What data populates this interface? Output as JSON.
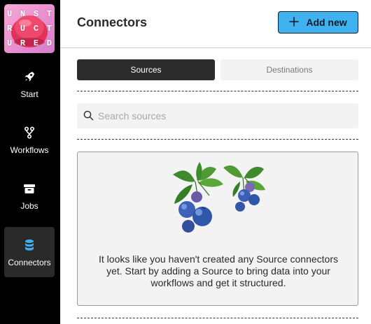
{
  "logo": {
    "rows": [
      [
        "U",
        "N",
        "S",
        "T"
      ],
      [
        "R",
        "U",
        "C",
        "T"
      ],
      [
        "U",
        "R",
        "E",
        "D"
      ]
    ]
  },
  "sidebar": {
    "items": [
      {
        "label": "Start",
        "icon": "rocket-icon"
      },
      {
        "label": "Workflows",
        "icon": "workflow-icon"
      },
      {
        "label": "Jobs",
        "icon": "archive-box-icon"
      },
      {
        "label": "Connectors",
        "icon": "database-icon",
        "active": true
      }
    ]
  },
  "header": {
    "title": "Connectors",
    "add_button_label": "Add new",
    "add_button_icon": "plus-icon"
  },
  "tabs": [
    {
      "label": "Sources",
      "active": true
    },
    {
      "label": "Destinations",
      "active": false
    }
  ],
  "search": {
    "placeholder": "Search sources",
    "value": "",
    "icon": "search-icon"
  },
  "empty_state": {
    "illustration": "blueberries-illustration",
    "message": "It looks like you haven't created any Source connectors yet. Start by adding a Source to bring data into your workflows and get it structured."
  },
  "colors": {
    "sidebar_bg": "#000000",
    "accent": "#3fb1ef",
    "active_tab_bg": "#2c2c2c",
    "card_bg": "#f3f3f3"
  }
}
